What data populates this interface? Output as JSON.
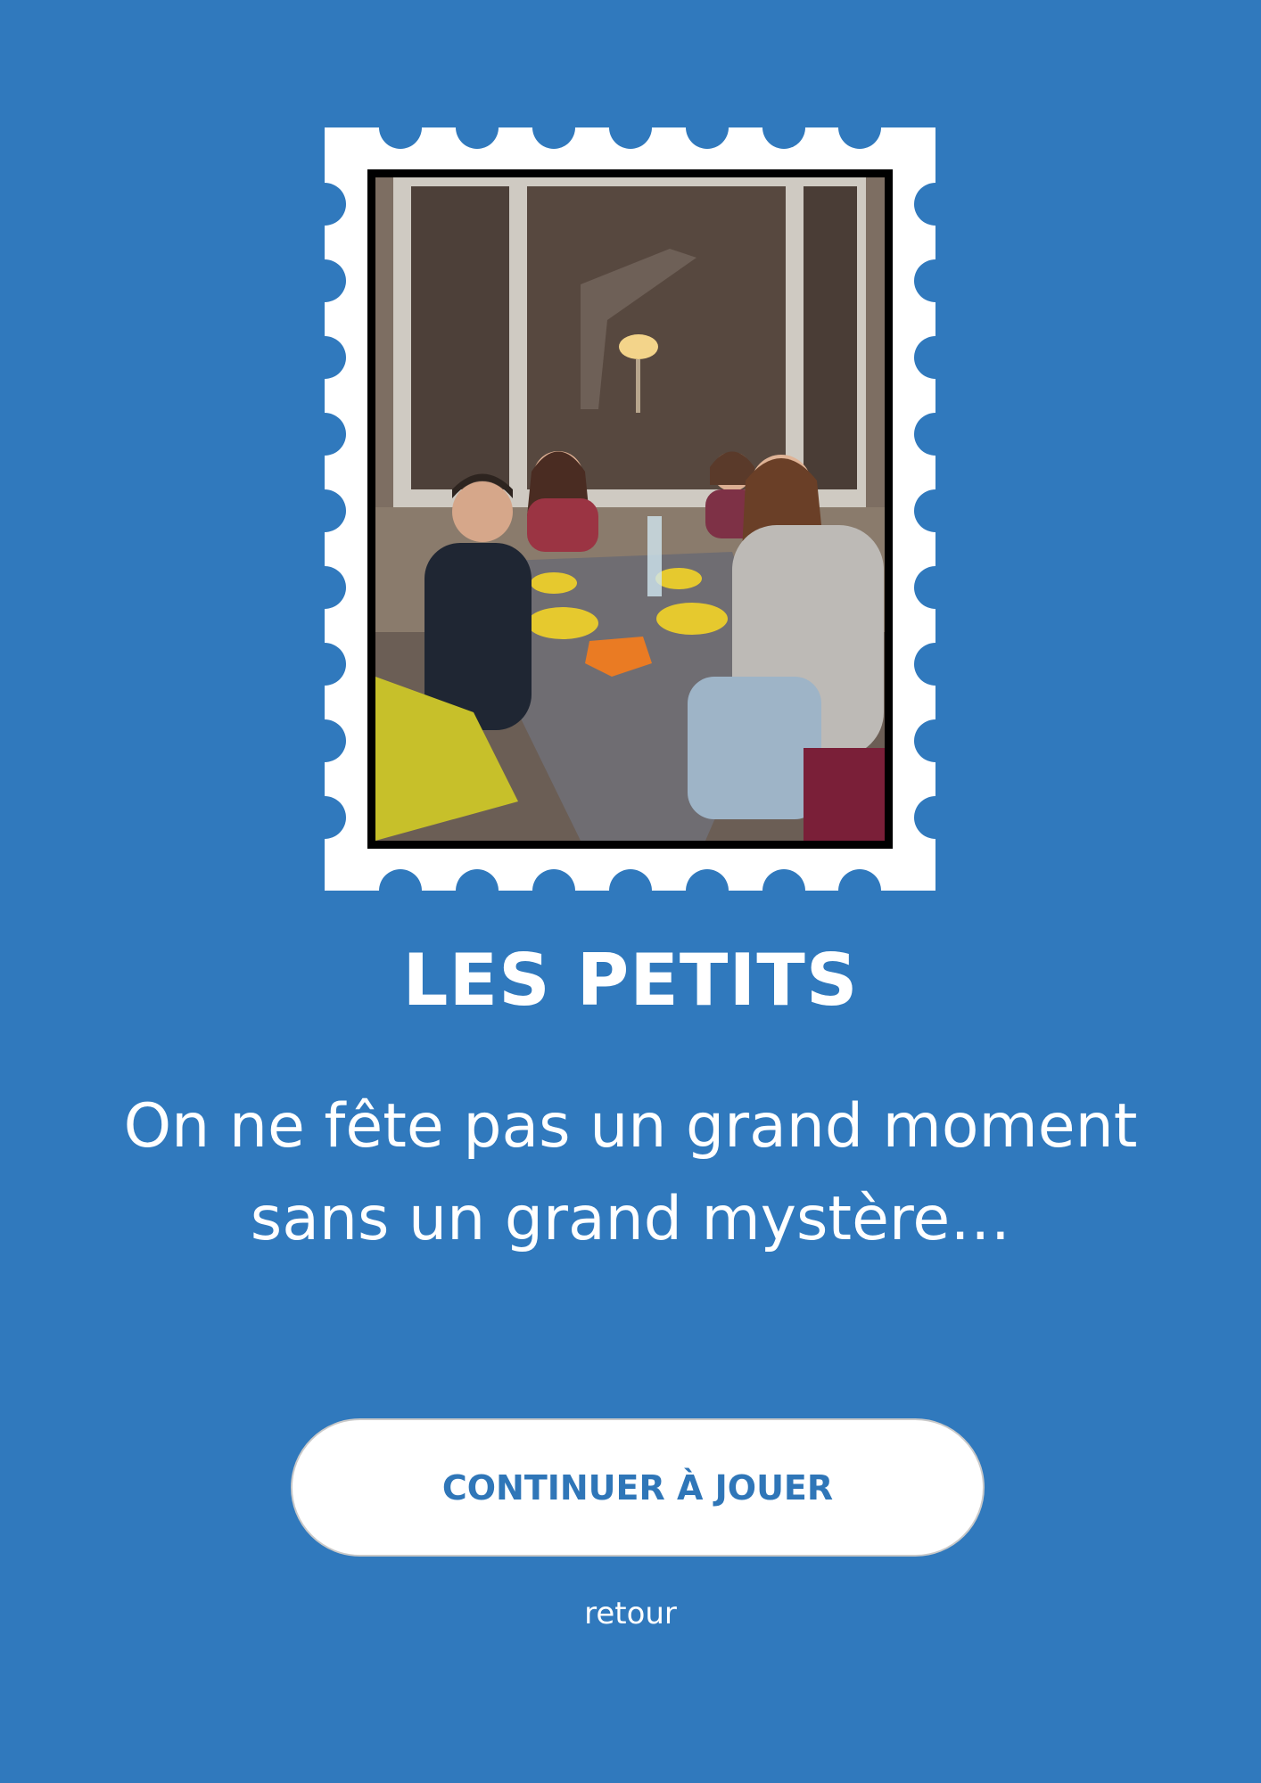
{
  "page": {
    "background_color": "#3079BD",
    "accent_text_color": "#2F76B8"
  },
  "stamp": {
    "frame_color": "#ffffff",
    "border_color": "#000000",
    "photo_icon": "family-dinner-photo"
  },
  "title": "LES PETITS",
  "subtitle": {
    "line1": "On ne fête pas un grand moment",
    "line2": "sans un grand mystère…"
  },
  "continue_button": {
    "label": "CONTINUER À JOUER"
  },
  "back_link": {
    "label": "retour"
  }
}
